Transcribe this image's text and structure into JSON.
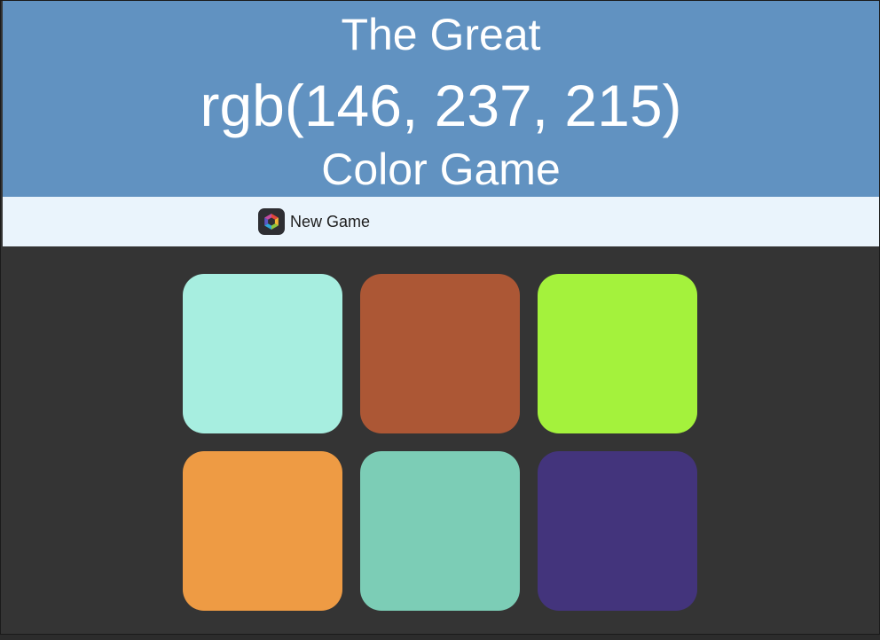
{
  "header": {
    "title_line1": "The Great",
    "rgb_target": "rgb(146, 237, 215)",
    "title_line3": "Color Game",
    "background_color": "#6192c1"
  },
  "toolbar": {
    "new_game_label": "New Game",
    "new_game_icon": "hexagon-cube-icon",
    "background_color": "#eaf4fc"
  },
  "board": {
    "background_color": "#343434",
    "squares": [
      {
        "color": "#a7eee0"
      },
      {
        "color": "#ac5735"
      },
      {
        "color": "#a4f23c"
      },
      {
        "color": "#ee9b44"
      },
      {
        "color": "#7ccdb6"
      },
      {
        "color": "#43347c"
      }
    ]
  }
}
